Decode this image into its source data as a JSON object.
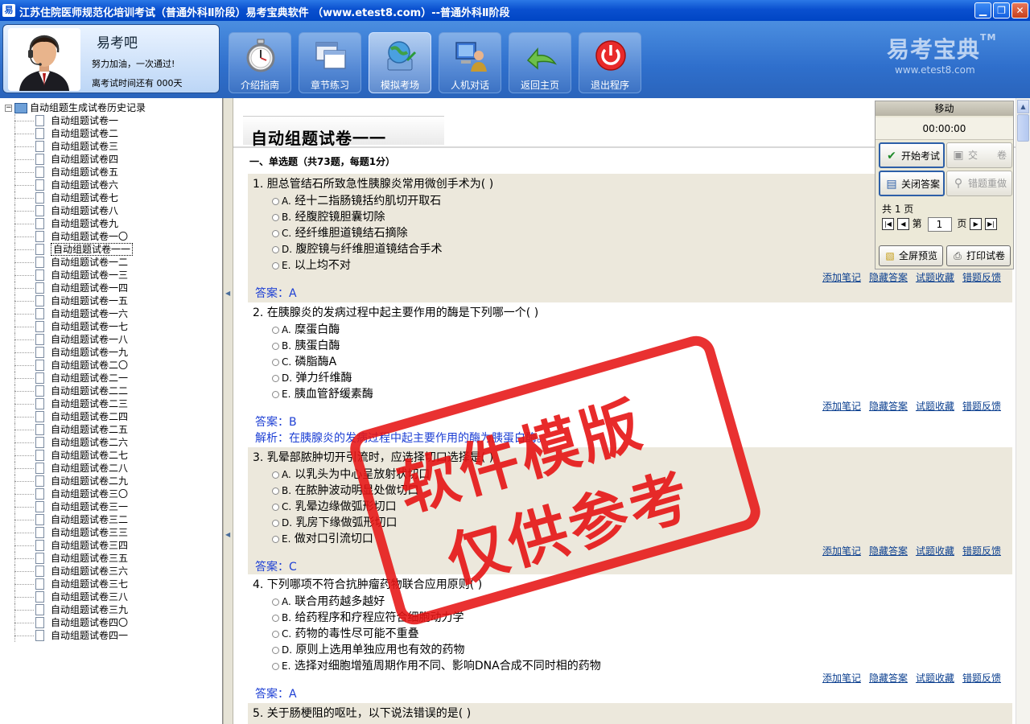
{
  "window": {
    "title": "江苏住院医师规范化培训考试（普通外科Ⅱ阶段）易考宝典软件 （www.etest8.com）--普通外科Ⅱ阶段",
    "app_icon_glyph": "易",
    "minimize": "▁",
    "restore": "❐",
    "close": "✕"
  },
  "user": {
    "name": "易考吧",
    "motto": "努力加油，一次通过!",
    "countdown": "离考试时间还有 000天"
  },
  "nav": [
    {
      "label": "介绍指南",
      "icon": "stopwatch-icon"
    },
    {
      "label": "章节练习",
      "icon": "windows-icon"
    },
    {
      "label": "模拟考场",
      "icon": "globe-icon"
    },
    {
      "label": "人机对话",
      "icon": "computer-user-icon"
    },
    {
      "label": "返回主页",
      "icon": "return-arrow-icon"
    },
    {
      "label": "退出程序",
      "icon": "power-icon"
    }
  ],
  "brand": {
    "name": "易考宝典",
    "tm": "TM",
    "url": "www.etest8.com"
  },
  "tree": {
    "root_label": "自动组题生成试卷历史记录",
    "expander": "−",
    "items": [
      "自动组题试卷一",
      "自动组题试卷二",
      "自动组题试卷三",
      "自动组题试卷四",
      "自动组题试卷五",
      "自动组题试卷六",
      "自动组题试卷七",
      "自动组题试卷八",
      "自动组题试卷九",
      "自动组题试卷一〇",
      "自动组题试卷一一",
      "自动组题试卷一二",
      "自动组题试卷一三",
      "自动组题试卷一四",
      "自动组题试卷一五",
      "自动组题试卷一六",
      "自动组题试卷一七",
      "自动组题试卷一八",
      "自动组题试卷一九",
      "自动组题试卷二〇",
      "自动组题试卷二一",
      "自动组题试卷二二",
      "自动组题试卷二三",
      "自动组题试卷二四",
      "自动组题试卷二五",
      "自动组题试卷二六",
      "自动组题试卷二七",
      "自动组题试卷二八",
      "自动组题试卷二九",
      "自动组题试卷三〇",
      "自动组题试卷三一",
      "自动组题试卷三二",
      "自动组题试卷三三",
      "自动组题试卷三四",
      "自动组题试卷三五",
      "自动组题试卷三六",
      "自动组题试卷三七",
      "自动组题试卷三八",
      "自动组题试卷三九",
      "自动组题试卷四〇",
      "自动组题试卷四一"
    ],
    "selected_index": 10
  },
  "paper": {
    "title": "自动组题试卷一一",
    "section": "一、单选题（共73题，每题1分）"
  },
  "question_links": [
    "添加笔记",
    "隐藏答案",
    "试题收藏",
    "错题反馈"
  ],
  "questions": [
    {
      "title": "1. 胆总管结石所致急性胰腺炎常用微创手术为(  )",
      "options": [
        [
          "A.",
          "经十二指肠镜括约肌切开取石"
        ],
        [
          "B.",
          "经腹腔镜胆囊切除"
        ],
        [
          "C.",
          "经纤维胆道镜结石摘除"
        ],
        [
          "D.",
          "腹腔镜与纤维胆道镜结合手术"
        ],
        [
          "E.",
          "以上均不对"
        ]
      ],
      "answer": "答案：A"
    },
    {
      "title": "2. 在胰腺炎的发病过程中起主要作用的酶是下列哪一个(  )",
      "options": [
        [
          "A.",
          "糜蛋白酶"
        ],
        [
          "B.",
          "胰蛋白酶"
        ],
        [
          "C.",
          "磷脂酶A"
        ],
        [
          "D.",
          "弹力纤维酶"
        ],
        [
          "E.",
          "胰血管舒缓素酶"
        ]
      ],
      "answer": "答案：B",
      "analysis": "解析：在胰腺炎的发病过程中起主要作用的酶为胰蛋白酶。"
    },
    {
      "title": "3. 乳晕部脓肿切开引流时，应选择切口选择是(  )",
      "options": [
        [
          "A.",
          "以乳头为中心呈放射状切口"
        ],
        [
          "B.",
          "在脓肿波动明显处做切口"
        ],
        [
          "C.",
          "乳晕边缘做弧形切口"
        ],
        [
          "D.",
          "乳房下缘做弧形切口"
        ],
        [
          "E.",
          "做对口引流切口"
        ]
      ],
      "answer": "答案：C"
    },
    {
      "title": "4. 下列哪项不符合抗肿瘤药物联合应用原则(  )",
      "options": [
        [
          "A.",
          "联合用药越多越好"
        ],
        [
          "B.",
          "给药程序和疗程应符合细胞动力学"
        ],
        [
          "C.",
          "药物的毒性尽可能不重叠"
        ],
        [
          "D.",
          "原则上选用单独应用也有效的药物"
        ],
        [
          "E.",
          "选择对细胞增殖周期作用不同、影响DNA合成不同时相的药物"
        ]
      ],
      "answer": "答案：A"
    },
    {
      "title": "5. 关于肠梗阻的呕吐，以下说法错误的是(  )"
    }
  ],
  "control": {
    "header": "移动",
    "timer": "00:00:00",
    "start_exam": "开始考试",
    "submit": "交　　卷",
    "close_answer": "关闭答案",
    "redo_wrong": "错题重做",
    "total_pages": "共 1 页",
    "page_prefix": "第",
    "page_value": "1",
    "page_suffix": "页",
    "full_preview": "全屏预览",
    "print_paper": "打印试卷"
  },
  "watermark": {
    "line1": "软件模版",
    "line2": "仅供参考"
  },
  "colors": {
    "title_bar": "#0a50cf",
    "header_bg": "#3a7bd5",
    "answer_text": "#1d3fd4",
    "stamp_red": "#e61414",
    "alt_block": "#ece8dc"
  }
}
